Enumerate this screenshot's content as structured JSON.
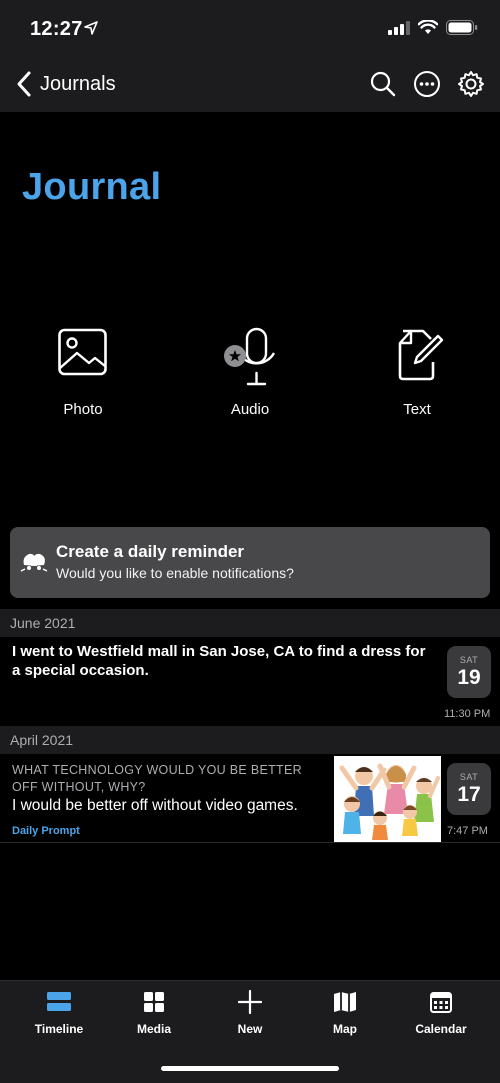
{
  "status_bar": {
    "time": "12:27"
  },
  "nav": {
    "back_label": "Journals",
    "actions": [
      "search-icon",
      "more-icon",
      "gear-icon"
    ]
  },
  "page": {
    "title": "Journal"
  },
  "entry_types": [
    {
      "label": "Photo",
      "icon": "photo-icon"
    },
    {
      "label": "Audio",
      "icon": "microphone-icon"
    },
    {
      "label": "Text",
      "icon": "text-edit-icon"
    }
  ],
  "reminder": {
    "title": "Create a daily reminder",
    "subtitle": "Would you like to enable notifications?"
  },
  "sections": [
    {
      "header": "June 2021",
      "entries": [
        {
          "text": "I went to Westfield mall in San Jose, CA to find a dress for a special occasion.",
          "weekday": "SAT",
          "day": "19",
          "time": "11:30 PM"
        }
      ]
    },
    {
      "header": "April 2021",
      "entries": [
        {
          "question": "WHAT TECHNOLOGY WOULD YOU BE BETTER OFF WITHOUT, WHY?",
          "text": "I would be better off without video games.",
          "tag": "Daily Prompt",
          "weekday": "SAT",
          "day": "17",
          "time": "7:47 PM",
          "has_photo": true
        }
      ]
    }
  ],
  "tabbar": [
    {
      "label": "Timeline",
      "icon": "timeline-icon",
      "active": true
    },
    {
      "label": "Media",
      "icon": "media-grid-icon"
    },
    {
      "label": "New",
      "icon": "plus-icon"
    },
    {
      "label": "Map",
      "icon": "map-icon"
    },
    {
      "label": "Calendar",
      "icon": "calendar-icon"
    }
  ],
  "colors": {
    "accent": "#4ba3ea",
    "background": "#000000",
    "bar": "#1c1c1e",
    "banner": "#48484a",
    "badge": "#3a3a3c"
  }
}
